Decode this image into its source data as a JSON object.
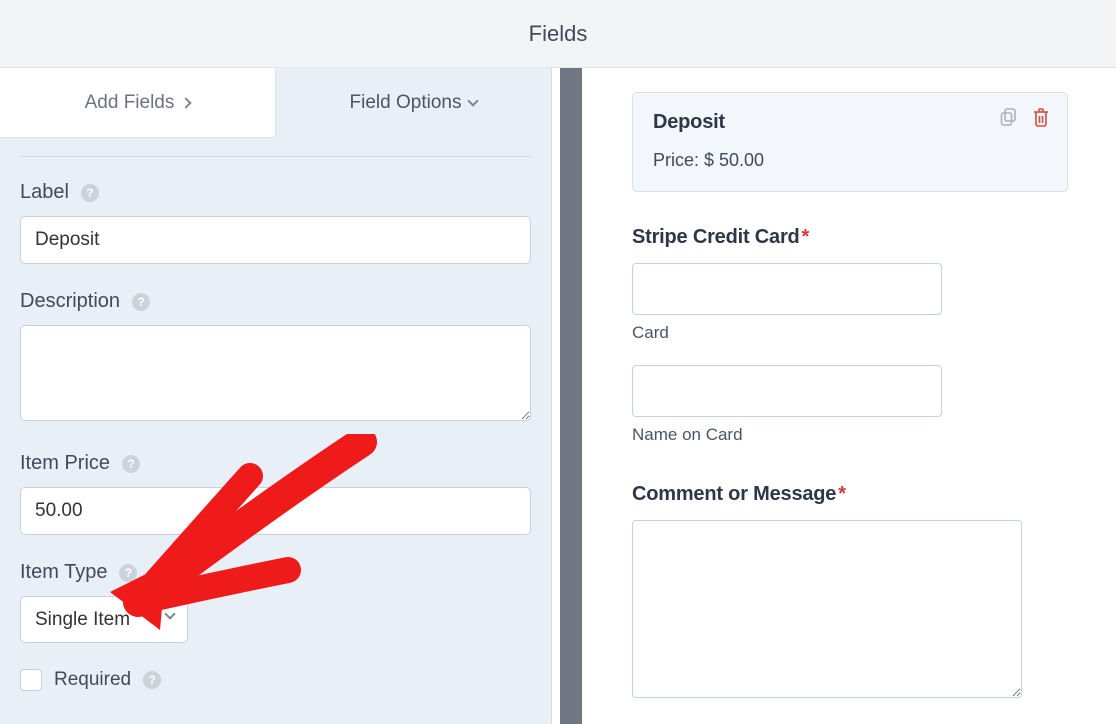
{
  "header": {
    "title": "Fields"
  },
  "tabs": {
    "add_fields": "Add Fields",
    "field_options": "Field Options"
  },
  "field_options": {
    "label": {
      "title": "Label",
      "value": "Deposit"
    },
    "description": {
      "title": "Description",
      "value": ""
    },
    "item_price": {
      "title": "Item Price",
      "value": "50.00"
    },
    "item_type": {
      "title": "Item Type",
      "value": "Single Item"
    },
    "required": {
      "title": "Required",
      "checked": false
    }
  },
  "preview": {
    "card": {
      "title": "Deposit",
      "price_label": "Price: $ 50.00"
    },
    "stripe": {
      "title": "Stripe Credit Card",
      "card_sub": "Card",
      "name_sub": "Name on Card"
    },
    "comment": {
      "title": "Comment or Message"
    }
  },
  "icons": {
    "help": "?",
    "duplicate": "duplicate-icon",
    "trash": "trash-icon"
  }
}
